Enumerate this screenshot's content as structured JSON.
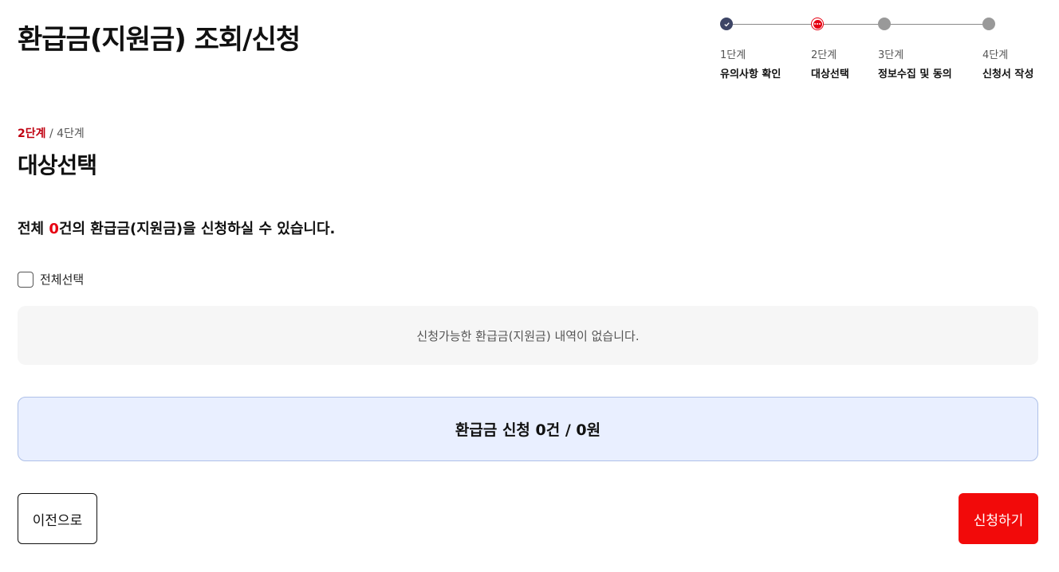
{
  "page": {
    "title": "환급금(지원금) 조회/신청"
  },
  "stepper": {
    "steps": [
      {
        "number": "1단계",
        "label": "유의사항 확인",
        "status": "done"
      },
      {
        "number": "2단계",
        "label": "대상선택",
        "status": "current"
      },
      {
        "number": "3단계",
        "label": "정보수집 및 동의",
        "status": "todo"
      },
      {
        "number": "4단계",
        "label": "신청서 작성",
        "status": "todo"
      }
    ]
  },
  "step_indicator": {
    "current": "2단계",
    "separator": " / ",
    "total": "4단계"
  },
  "section": {
    "title": "대상선택"
  },
  "summary": {
    "prefix": "전체 ",
    "count": "0",
    "suffix": "건의 환급금(지원금)을 신청하실 수 있습니다."
  },
  "select_all": {
    "label": "전체선택",
    "checked": false
  },
  "empty_message": "신청가능한 환급금(지원금) 내역이 없습니다.",
  "total": {
    "text": "환급금 신청 0건 / 0원"
  },
  "buttons": {
    "prev": "이전으로",
    "submit": "신청하기"
  },
  "colors": {
    "accent": "#e60012",
    "done_dot": "#3d4566",
    "todo_dot": "#999999",
    "total_bg": "#e9efff",
    "submit_bg": "#f20a0a"
  }
}
